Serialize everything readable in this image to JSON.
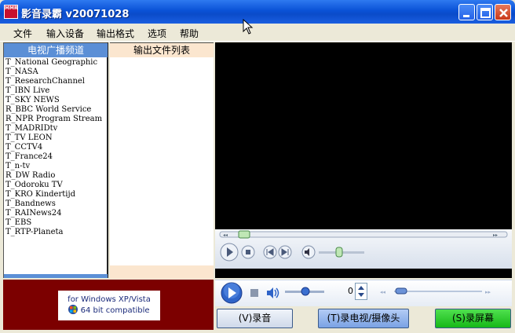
{
  "window": {
    "title": "影音录霸  v20071028",
    "icon_text": "MMR"
  },
  "menu": [
    "文件",
    "输入设备",
    "输出格式",
    "选项",
    "帮助"
  ],
  "channels": {
    "header": "电视广播频道",
    "items": [
      "T_National Geographic",
      "T_NASA",
      "T_ResearchChannel",
      "T_IBN Live",
      "T_SKY NEWS",
      "R_BBC World Service",
      "R_NPR Program Stream",
      "T_MADRIDtv",
      "T_TV LEON",
      "T_CCTV4",
      "T_France24",
      "T_n-tv",
      "R_DW Radio",
      "T_Odoroku TV",
      "T_KRO Kindertijd",
      "T_Bandnews",
      "T_RAINews24",
      "T_EBS",
      "T_RTP-Planeta"
    ]
  },
  "output": {
    "header": "输出文件列表"
  },
  "compat": {
    "line1": "for Windows XP/Vista",
    "line2": "64 bit compatible"
  },
  "controls": {
    "counter": "0"
  },
  "buttons": {
    "audio": "(V)录音",
    "tv": "(T)录电视/摄像头",
    "screen": "(S)录屏幕"
  },
  "colors": {
    "titlebar": "#0a52d6",
    "banner": "#7c0000",
    "record_screen": "#17b817"
  }
}
